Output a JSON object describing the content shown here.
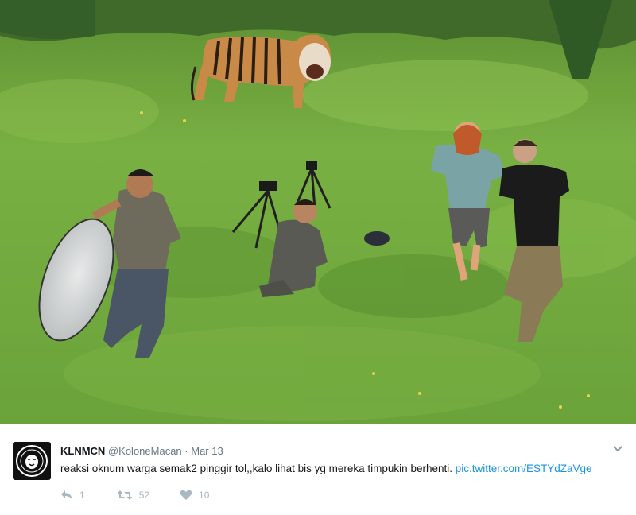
{
  "tweet": {
    "display_name": "KLNMCN",
    "handle": "@KoloneMacan",
    "separator": "·",
    "date": "Mar 13",
    "text": "reaksi oknum warga semak2 pinggir tol,,kalo lihat bis yg mereka timpukin berhenti. ",
    "link": "pic.twitter.com/ESTYdZaVge",
    "reply_count": "1",
    "retweet_count": "52",
    "like_count": "10"
  },
  "icons": {
    "avatar": "tiger-emblem-icon",
    "reply": "reply-icon",
    "retweet": "retweet-icon",
    "like": "heart-icon",
    "menu": "chevron-down-icon"
  },
  "colors": {
    "grass": "#6fa63a",
    "link": "#1b95e0",
    "muted": "#657786",
    "action_icons": "#aab8c2"
  }
}
